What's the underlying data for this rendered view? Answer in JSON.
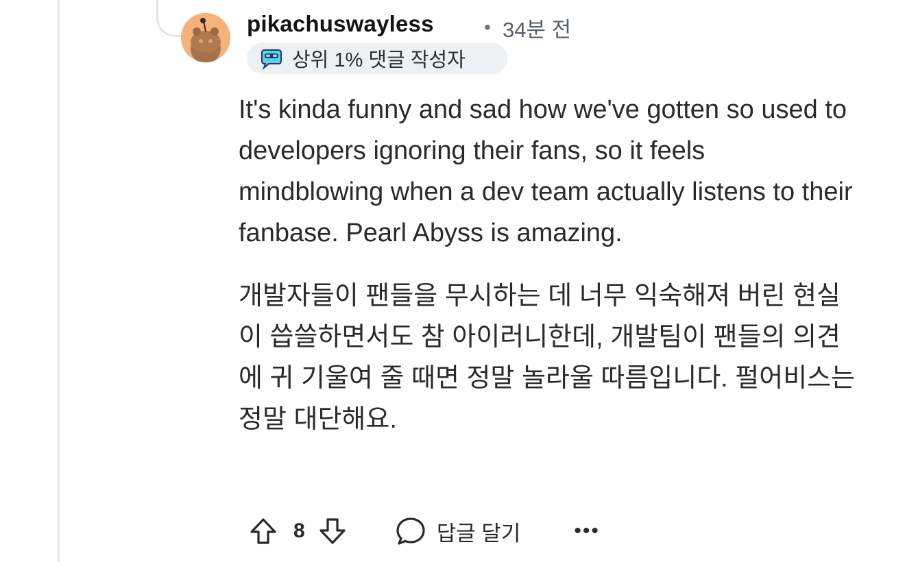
{
  "comment": {
    "author": "pikachuswayless",
    "separator": "•",
    "time_ago": "34분 전",
    "flair": {
      "icon": "top-commenter-icon",
      "label": "상위 1% 댓글 작성자"
    },
    "body_en": "It's kinda funny and sad how we've gotten so used to developers ignoring their fans, so it feels mindblowing when a dev team actually listens to their fanbase. Pearl Abyss is amazing.",
    "body_ko": "개발자들이 팬들을 무시하는 데 너무 익숙해져 버린 현실이 씁쓸하면서도 참 아이러니한데, 개발팀이 팬들의 의견에 귀 기울여 줄 때면 정말 놀라울 따름입니다. 펄어비스는 정말 대단해요."
  },
  "actions": {
    "upvote_icon": "upvote-arrow-icon",
    "vote_count": "8",
    "downvote_icon": "downvote-arrow-icon",
    "reply_icon": "speech-bubble-icon",
    "reply_label": "답글 달기",
    "more_label": "•••"
  },
  "colors": {
    "avatar_bg": "#f6b27a",
    "flair_bg": "#eef1f4",
    "thread_line": "#e5e7eb",
    "text": "#2a2a2a",
    "muted": "#576069"
  }
}
